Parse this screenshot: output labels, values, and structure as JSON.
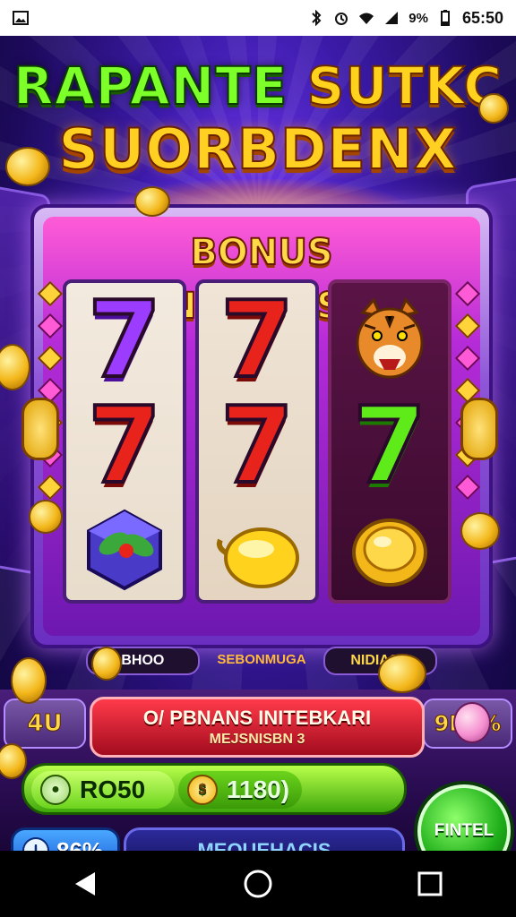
{
  "status_bar": {
    "time": "65:50",
    "battery": "9%"
  },
  "game": {
    "title_line1_part1": "RAPANTE",
    "title_line1_part2": "SUTKC",
    "title_line2": "SUORBDENX",
    "bonus_banner": "BONUS INNEIEDASAI!",
    "reel_labels": [
      "BHOO",
      "SEBONMUGA",
      "NIDIASO"
    ],
    "left_side_value": "4U",
    "right_side_value": "9PF%",
    "info_banner": {
      "line1": "O/ PBNANS INITEBKARI",
      "line2": "MEJSNISBN 3"
    },
    "credits": {
      "value_a": "RO50",
      "value_b": "1180)"
    },
    "percent": "86%",
    "wide_button_label": "MEQUEHACIS",
    "spin_button_label": "FINTEL",
    "reels": [
      [
        "7-purple",
        "7-red",
        "gem-box"
      ],
      [
        "7-red",
        "7-red",
        "banana"
      ],
      [
        "tiger",
        "7-green",
        "gold-coin"
      ]
    ],
    "colors": {
      "accent_gold": "#ffd84a",
      "spin_green": "#1fae1a",
      "banner_red": "#a20c1e",
      "background_purple": "#3b1aa8"
    }
  },
  "navigation": {
    "back_icon": "back-triangle-icon",
    "home_icon": "home-circle-icon",
    "recents_icon": "recents-square-icon"
  }
}
